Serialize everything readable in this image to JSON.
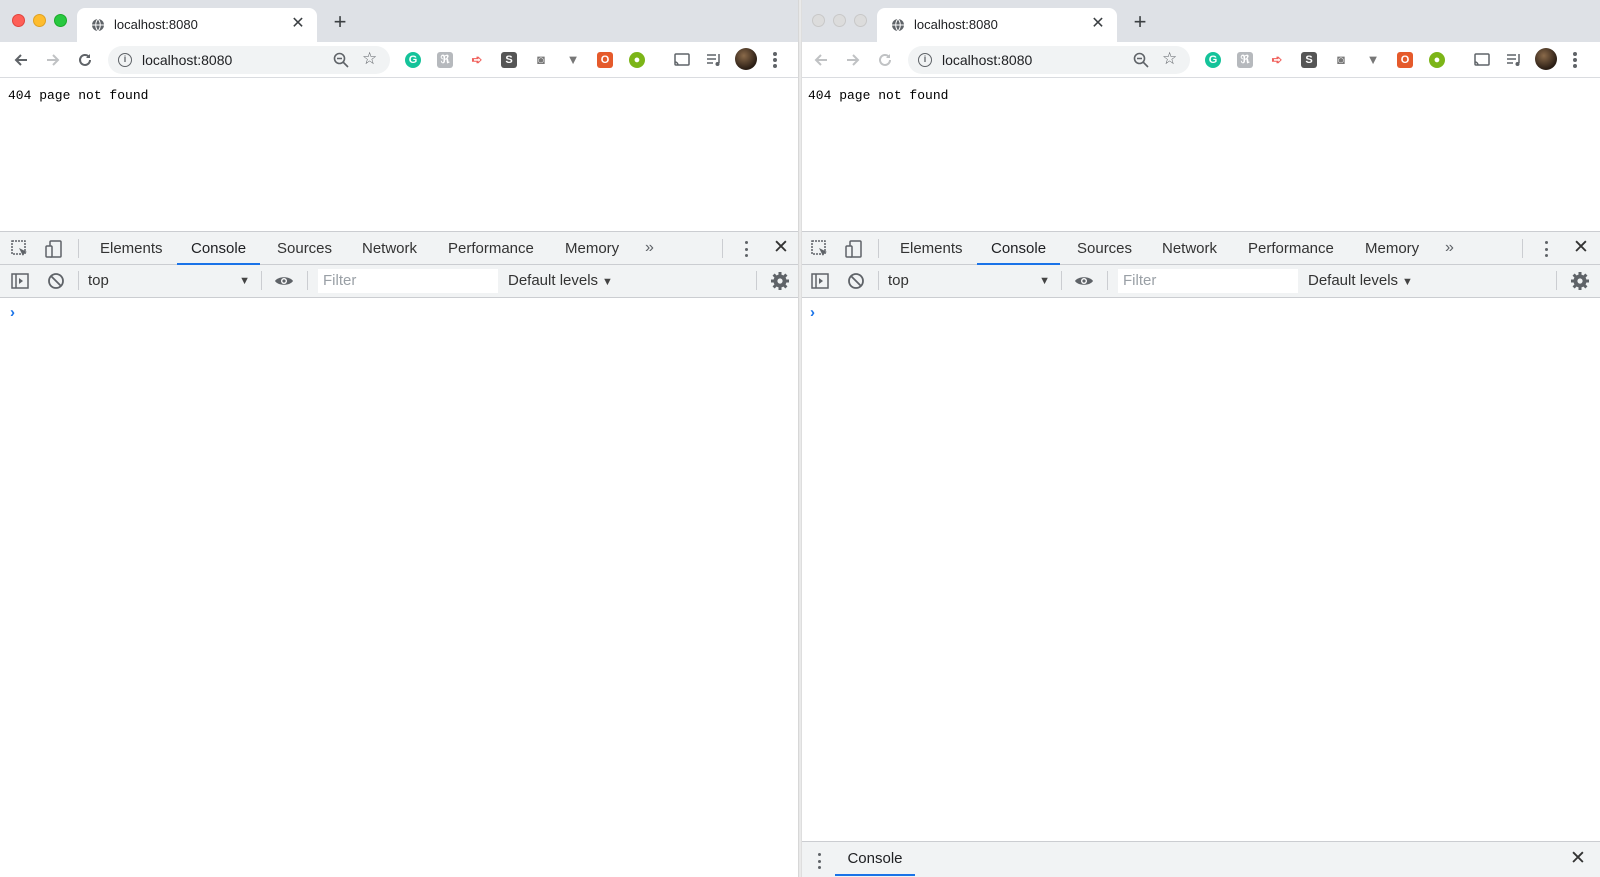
{
  "windows": [
    {
      "tab": {
        "title": "localhost:8080"
      },
      "address": {
        "url": "localhost:8080"
      },
      "page": {
        "text": "404 page not found"
      },
      "devtools": {
        "tabs": [
          "Elements",
          "Console",
          "Sources",
          "Network",
          "Performance",
          "Memory"
        ],
        "active_tab": "Console",
        "context": "top",
        "filter_placeholder": "Filter",
        "levels": "Default levels"
      }
    },
    {
      "tab": {
        "title": "localhost:8080"
      },
      "address": {
        "url": "localhost:8080"
      },
      "page": {
        "text": "404 page not found"
      },
      "devtools": {
        "tabs": [
          "Elements",
          "Console",
          "Sources",
          "Network",
          "Performance",
          "Memory"
        ],
        "active_tab": "Console",
        "context": "top",
        "filter_placeholder": "Filter",
        "levels": "Default levels"
      },
      "drawer": {
        "tab": "Console"
      }
    }
  ],
  "colors": {
    "accent": "#1a73e8",
    "tabstrip_bg": "#dee1e6",
    "devtools_bar_bg": "#f1f3f4"
  },
  "extensions": [
    "grammarly-icon",
    "reflect-icon",
    "tag-icon",
    "s-icon",
    "camera-icon",
    "vue-devtools-icon",
    "office-icon",
    "hub-icon"
  ]
}
